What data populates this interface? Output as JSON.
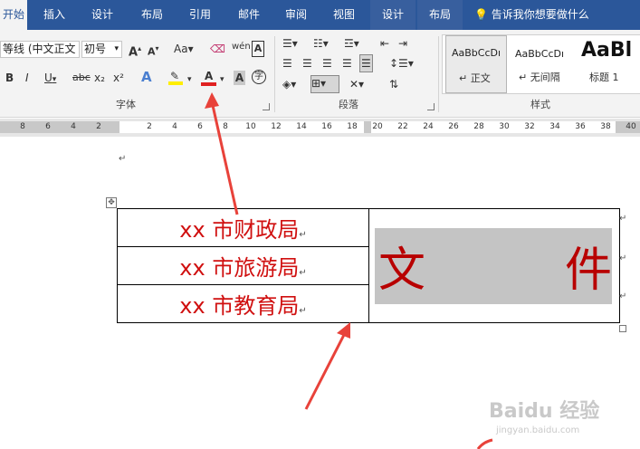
{
  "tabs": [
    {
      "label": "开始",
      "state": "active"
    },
    {
      "label": "插入",
      "state": "normal"
    },
    {
      "label": "设计",
      "state": "normal"
    },
    {
      "label": "布局",
      "state": "normal"
    },
    {
      "label": "引用",
      "state": "normal"
    },
    {
      "label": "邮件",
      "state": "normal"
    },
    {
      "label": "审阅",
      "state": "normal"
    },
    {
      "label": "视图",
      "state": "normal"
    },
    {
      "label": "设计",
      "state": "contextual"
    },
    {
      "label": "布局",
      "state": "contextual"
    }
  ],
  "tell_me": "告诉我你想要做什么",
  "font": {
    "font_name": "等线 (中文正文",
    "font_size": "初号",
    "group_label": "字体",
    "aa_label": "Aa",
    "wen_label": "wén",
    "a_label": "A",
    "bold": "B",
    "italic": "I",
    "underline": "U",
    "strike": "abc",
    "subscript": "x₂",
    "superscript": "x²",
    "char_border": "字"
  },
  "paragraph": {
    "group_label": "段落"
  },
  "styles": {
    "group_label": "样式",
    "items": [
      {
        "preview": "AaBbCcDı",
        "name": "↵ 正文"
      },
      {
        "preview": "AaBbCcDı",
        "name": "↵ 无间隔"
      },
      {
        "preview": "AaBl",
        "name": "标题 1"
      }
    ]
  },
  "ruler": {
    "left_ticks": [
      "8",
      "6",
      "4",
      "2"
    ],
    "right_ticks": [
      "2",
      "4",
      "6",
      "8",
      "10",
      "12",
      "14",
      "16",
      "18",
      "20",
      "22",
      "24",
      "26",
      "28",
      "30",
      "32",
      "34",
      "36",
      "38",
      "40"
    ]
  },
  "document": {
    "paragraph_mark": "↵",
    "table_handle": "✥",
    "orgs": [
      "xx 市财政局",
      "xx 市旅游局",
      "xx 市教育局"
    ],
    "wen_chars": [
      "文",
      "件"
    ]
  },
  "watermark": {
    "brand": "Baidu 经验",
    "url": "jingyan.baidu.com"
  },
  "colors": {
    "ribbon_blue": "#2b579a",
    "text_red": "#d01010",
    "wen_red": "#b80000",
    "shade_gray": "#c4c4c4",
    "arrow_red": "#e8423a"
  }
}
